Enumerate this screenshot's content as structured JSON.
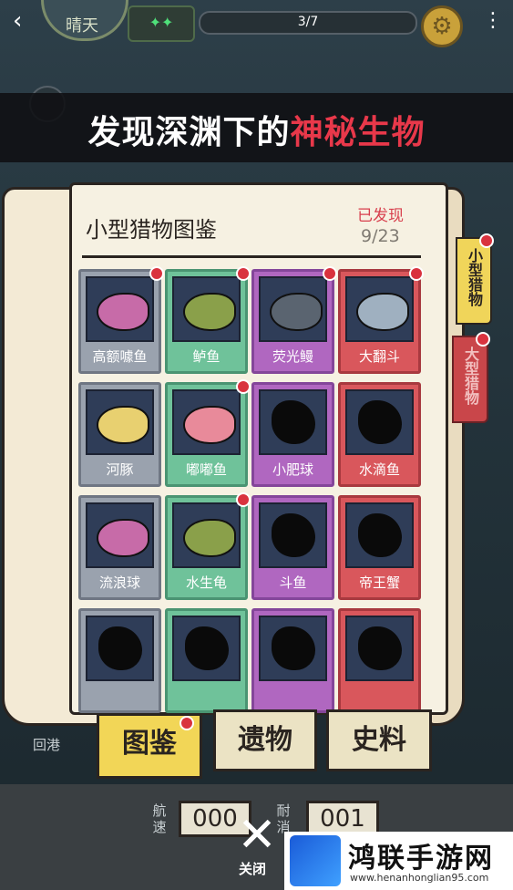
{
  "topbar": {
    "weather": "晴天",
    "progress": "3/7"
  },
  "banner": {
    "white": "发现深渊下的",
    "red": "神秘生物"
  },
  "book": {
    "title": "小型猎物图鉴",
    "found_label": "已发现",
    "found_count": "9/23"
  },
  "side_tabs": [
    "小型猎物",
    "大型猎物"
  ],
  "creatures": [
    {
      "name": "高额噱鱼",
      "rarity": "gray",
      "new": true
    },
    {
      "name": "鲈鱼",
      "rarity": "green",
      "new": true
    },
    {
      "name": "荧光鳗",
      "rarity": "purple",
      "new": true
    },
    {
      "name": "大翻斗",
      "rarity": "red",
      "new": true
    },
    {
      "name": "河豚",
      "rarity": "gray",
      "new": false
    },
    {
      "name": "嘟嘟鱼",
      "rarity": "green",
      "new": true
    },
    {
      "name": "小肥球",
      "rarity": "purple",
      "new": false
    },
    {
      "name": "水滴鱼",
      "rarity": "red",
      "new": false
    },
    {
      "name": "流浪球",
      "rarity": "gray",
      "new": false
    },
    {
      "name": "水生龟",
      "rarity": "green",
      "new": true
    },
    {
      "name": "斗鱼",
      "rarity": "purple",
      "new": false
    },
    {
      "name": "帝王蟹",
      "rarity": "red",
      "new": false
    },
    {
      "name": "",
      "rarity": "gray",
      "new": false
    },
    {
      "name": "",
      "rarity": "green",
      "new": false
    },
    {
      "name": "",
      "rarity": "purple",
      "new": false
    },
    {
      "name": "",
      "rarity": "red",
      "new": false
    }
  ],
  "bottom_tabs": [
    "图鉴",
    "遗物",
    "史料"
  ],
  "dashboard": {
    "speed_label": "航速",
    "speed_value": "000",
    "durability_label": "耐消",
    "durability_value": "001",
    "harbor": "回港",
    "close": "关闭"
  },
  "watermark": {
    "title": "鸿联手游网",
    "url": "www.henanhonglian95.com"
  }
}
